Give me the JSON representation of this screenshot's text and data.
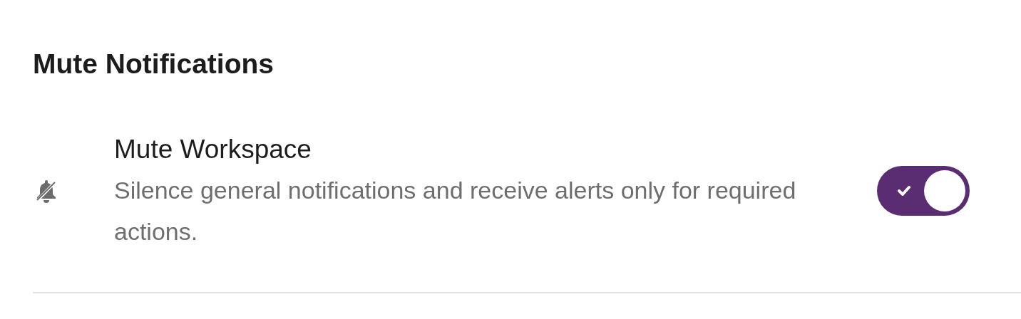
{
  "section": {
    "title": "Mute Notifications",
    "settings": [
      {
        "kind": "toggle",
        "title": "Mute Workspace",
        "description": "Silence general notifications and receive alerts only for required actions.",
        "on": true
      }
    ]
  }
}
